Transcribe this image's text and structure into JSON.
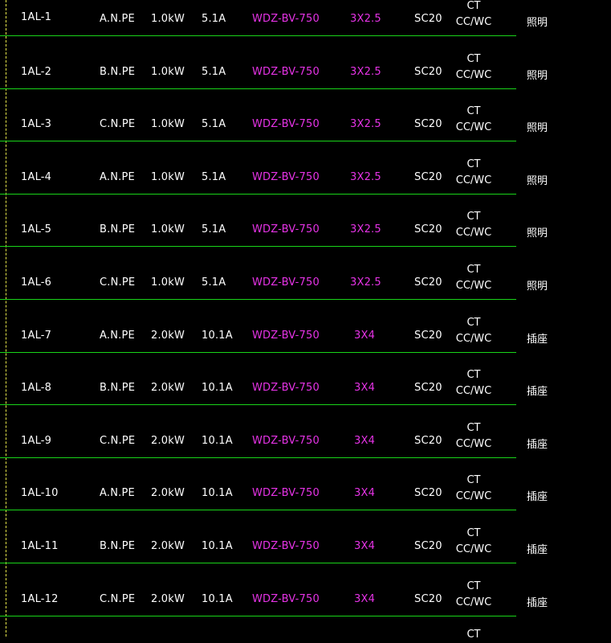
{
  "colors": {
    "background": "#000000",
    "text": "#ffffff",
    "cable": "#e633e6",
    "separator": "#19d419",
    "axis": "#e6e64a"
  },
  "circuits": [
    {
      "id": "1AL-1",
      "phase": "A.N.PE",
      "power": "1.0kW",
      "current": "5.1A",
      "cable": "WDZ-BV-750",
      "size": "3X2.5",
      "conduit": "SC20",
      "lay1": "CT",
      "lay2": "CC/WC",
      "use": "照明"
    },
    {
      "id": "1AL-2",
      "phase": "B.N.PE",
      "power": "1.0kW",
      "current": "5.1A",
      "cable": "WDZ-BV-750",
      "size": "3X2.5",
      "conduit": "SC20",
      "lay1": "CT",
      "lay2": "CC/WC",
      "use": "照明"
    },
    {
      "id": "1AL-3",
      "phase": "C.N.PE",
      "power": "1.0kW",
      "current": "5.1A",
      "cable": "WDZ-BV-750",
      "size": "3X2.5",
      "conduit": "SC20",
      "lay1": "CT",
      "lay2": "CC/WC",
      "use": "照明"
    },
    {
      "id": "1AL-4",
      "phase": "A.N.PE",
      "power": "1.0kW",
      "current": "5.1A",
      "cable": "WDZ-BV-750",
      "size": "3X2.5",
      "conduit": "SC20",
      "lay1": "CT",
      "lay2": "CC/WC",
      "use": "照明"
    },
    {
      "id": "1AL-5",
      "phase": "B.N.PE",
      "power": "1.0kW",
      "current": "5.1A",
      "cable": "WDZ-BV-750",
      "size": "3X2.5",
      "conduit": "SC20",
      "lay1": "CT",
      "lay2": "CC/WC",
      "use": "照明"
    },
    {
      "id": "1AL-6",
      "phase": "C.N.PE",
      "power": "1.0kW",
      "current": "5.1A",
      "cable": "WDZ-BV-750",
      "size": "3X2.5",
      "conduit": "SC20",
      "lay1": "CT",
      "lay2": "CC/WC",
      "use": "照明"
    },
    {
      "id": "1AL-7",
      "phase": "A.N.PE",
      "power": "2.0kW",
      "current": "10.1A",
      "cable": "WDZ-BV-750",
      "size": "3X4",
      "conduit": "SC20",
      "lay1": "CT",
      "lay2": "CC/WC",
      "use": "插座"
    },
    {
      "id": "1AL-8",
      "phase": "B.N.PE",
      "power": "2.0kW",
      "current": "10.1A",
      "cable": "WDZ-BV-750",
      "size": "3X4",
      "conduit": "SC20",
      "lay1": "CT",
      "lay2": "CC/WC",
      "use": "插座"
    },
    {
      "id": "1AL-9",
      "phase": "C.N.PE",
      "power": "2.0kW",
      "current": "10.1A",
      "cable": "WDZ-BV-750",
      "size": "3X4",
      "conduit": "SC20",
      "lay1": "CT",
      "lay2": "CC/WC",
      "use": "插座"
    },
    {
      "id": "1AL-10",
      "phase": "A.N.PE",
      "power": "2.0kW",
      "current": "10.1A",
      "cable": "WDZ-BV-750",
      "size": "3X4",
      "conduit": "SC20",
      "lay1": "CT",
      "lay2": "CC/WC",
      "use": "插座"
    },
    {
      "id": "1AL-11",
      "phase": "B.N.PE",
      "power": "2.0kW",
      "current": "10.1A",
      "cable": "WDZ-BV-750",
      "size": "3X4",
      "conduit": "SC20",
      "lay1": "CT",
      "lay2": "CC/WC",
      "use": "插座"
    },
    {
      "id": "1AL-12",
      "phase": "C.N.PE",
      "power": "2.0kW",
      "current": "10.1A",
      "cable": "WDZ-BV-750",
      "size": "3X4",
      "conduit": "SC20",
      "lay1": "CT",
      "lay2": "CC/WC",
      "use": "插座"
    }
  ],
  "next_row_partial": {
    "lay1": "CT"
  }
}
